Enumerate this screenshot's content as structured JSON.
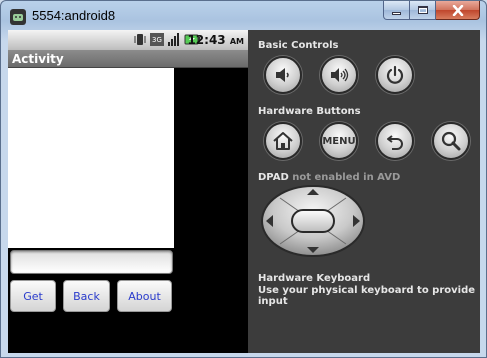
{
  "window": {
    "title": "5554:android8"
  },
  "statusbar": {
    "network": "3G",
    "clock": "12:43",
    "clock_ampm": "AM"
  },
  "activity": {
    "title": "Activity",
    "text_value": "",
    "buttons": {
      "get": "Get",
      "back": "Back",
      "about": "About"
    }
  },
  "controls": {
    "basic_title": "Basic Controls",
    "hardware_title": "Hardware Buttons",
    "menu_label": "MENU",
    "dpad_title": "DPAD",
    "dpad_note": "not enabled in AVD",
    "keyboard_title": "Hardware Keyboard",
    "keyboard_note": "Use your physical keyboard to provide input"
  }
}
